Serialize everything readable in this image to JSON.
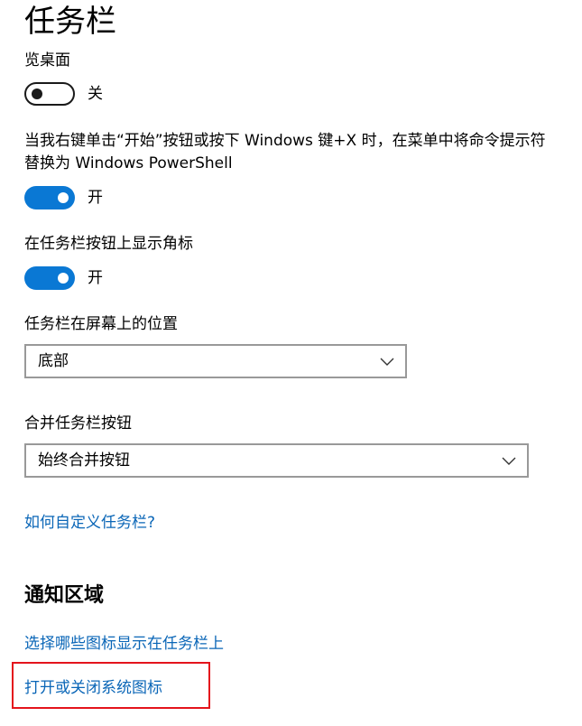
{
  "page": {
    "title": "任务栏"
  },
  "settings": {
    "desktop_preview": {
      "label": "览桌面",
      "state_text": "关",
      "enabled": false
    },
    "powershell": {
      "label": "当我右键单击“开始”按钮或按下 Windows 键+X 时，在菜单中将命令提示符替换为 Windows PowerShell",
      "state_text": "开",
      "enabled": true
    },
    "badges": {
      "label": "在任务栏按钮上显示角标",
      "state_text": "开",
      "enabled": true
    },
    "position": {
      "label": "任务栏在屏幕上的位置",
      "value": "底部"
    },
    "combine": {
      "label": "合并任务栏按钮",
      "value": "始终合并按钮"
    }
  },
  "links": {
    "customize": "如何自定义任务栏?"
  },
  "notification_area": {
    "title": "通知区域",
    "select_icons": "选择哪些图标显示在任务栏上",
    "system_icons": "打开或关闭系统图标"
  },
  "colors": {
    "accent": "#0a78d4",
    "link": "#0a66b7",
    "highlight": "#e4141c"
  }
}
